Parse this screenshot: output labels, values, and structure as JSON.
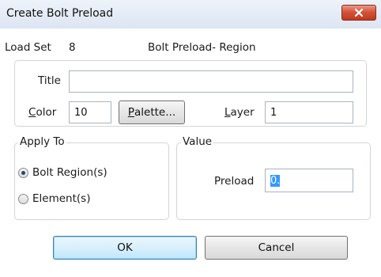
{
  "window": {
    "title": "Create Bolt Preload"
  },
  "header": {
    "load_set_label": "Load Set",
    "load_set_value": "8",
    "region_label": "Bolt Preload- Region"
  },
  "fields": {
    "title_label": "Title",
    "title_value": "",
    "color_label_underline": "C",
    "color_label_rest": "olor",
    "color_value": "10",
    "palette_button_underline": "P",
    "palette_button_rest": "alette...",
    "layer_label_underline": "L",
    "layer_label_rest": "ayer",
    "layer_value": "1"
  },
  "apply_to": {
    "legend": "Apply To",
    "options": [
      {
        "label": "Bolt Region(s)",
        "checked": true
      },
      {
        "label": "Element(s)",
        "checked": false
      }
    ]
  },
  "value_group": {
    "legend": "Value",
    "preload_label": "Preload",
    "preload_value": "0."
  },
  "buttons": {
    "ok": "OK",
    "cancel": "Cancel"
  },
  "icons": {
    "close": "close-icon"
  },
  "colors": {
    "close_button": "#c74a31",
    "ok_border": "#3c7fb1",
    "selection": "#3399ff"
  }
}
